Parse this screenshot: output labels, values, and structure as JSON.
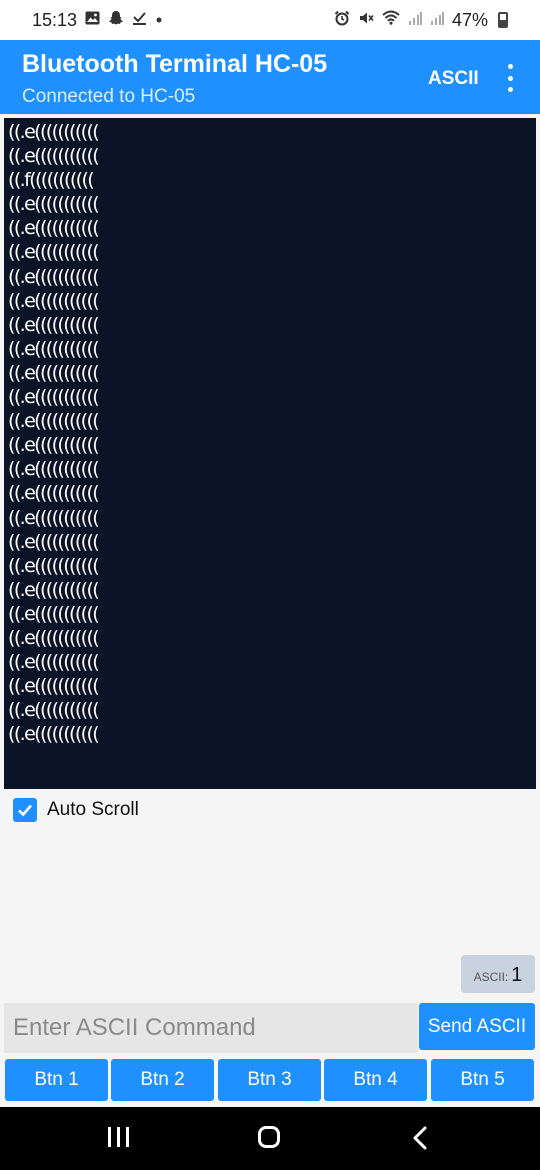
{
  "status_bar": {
    "time": "15:13",
    "notification_icons": [
      "gallery-icon",
      "snapchat-icon",
      "download-done-icon",
      "dot-icon"
    ],
    "system_icons": [
      "alarm-icon",
      "mute-icon",
      "wifi-icon",
      "signal-icon",
      "signal-icon"
    ],
    "battery": "47%"
  },
  "app_bar": {
    "title": "Bluetooth Terminal HC-05",
    "subtitle": "Connected to HC-05",
    "mode_label": "ASCII",
    "accent_color": "#1e90ff"
  },
  "terminal": {
    "background": "#0b1426",
    "lines": [
      "((.e(((((((((((",
      "((.e(((((((((((",
      "((.f(((((((((((",
      "((.e(((((((((((",
      "((.e(((((((((((",
      "((.e(((((((((((",
      "((.e(((((((((((",
      "((.e(((((((((((",
      "((.e(((((((((((",
      "((.e(((((((((((",
      "((.e(((((((((((",
      "((.e(((((((((((",
      "((.e(((((((((((",
      "((.e(((((((((((",
      "((.e(((((((((((",
      "((.e(((((((((((",
      "((.e(((((((((((",
      "((.e(((((((((((",
      "((.e(((((((((((",
      "((.e(((((((((((",
      "((.e(((((((((((",
      "((.e(((((((((((",
      "((.e(((((((((((",
      "((.e(((((((((((",
      "((.e(((((((((((",
      "((.e((((((((((("
    ]
  },
  "auto_scroll": {
    "label": "Auto Scroll",
    "checked": true
  },
  "ascii_counter": {
    "label": "ASCII:",
    "value": "1"
  },
  "command": {
    "placeholder": "Enter ASCII Command",
    "value": "",
    "send_label": "Send ASCII"
  },
  "buttons": [
    {
      "label": "Btn 1"
    },
    {
      "label": "Btn 2"
    },
    {
      "label": "Btn 3"
    },
    {
      "label": "Btn 4"
    },
    {
      "label": "Btn 5"
    }
  ]
}
